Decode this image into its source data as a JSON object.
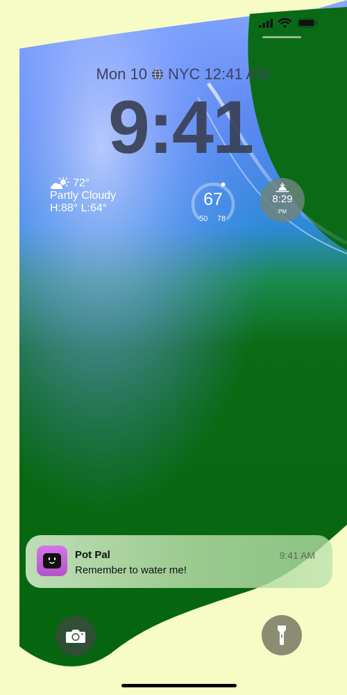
{
  "status_bar": {
    "signal_icon": "cellular-signal-icon",
    "wifi_icon": "wifi-icon",
    "battery_icon": "battery-icon"
  },
  "lock_screen": {
    "date_text": "Mon 10",
    "world_clock_icon": "globe-icon",
    "city_time": "NYC 12:41 AM",
    "time": "9:41"
  },
  "widgets": {
    "weather": {
      "icon": "partly-cloudy-icon",
      "temperature": "72°",
      "condition": "Partly Cloudy",
      "high_low": "H:88° L:64°"
    },
    "temperature_gauge": {
      "value": "67",
      "min": "50",
      "max": "78"
    },
    "sunset": {
      "icon": "sunset-icon",
      "time": "8:29",
      "period": "PM"
    }
  },
  "notification": {
    "app_name": "Pot Pal",
    "time": "9:41 AM",
    "message": "Remember to water me!"
  },
  "quick_actions": {
    "camera_icon": "camera-icon",
    "flashlight_icon": "flashlight-icon"
  },
  "colors": {
    "background": "#f7fcc6",
    "wallpaper_green": "#0a6b14",
    "wallpaper_blue": "#3f8ff0",
    "clock_text": "#3a4156"
  }
}
